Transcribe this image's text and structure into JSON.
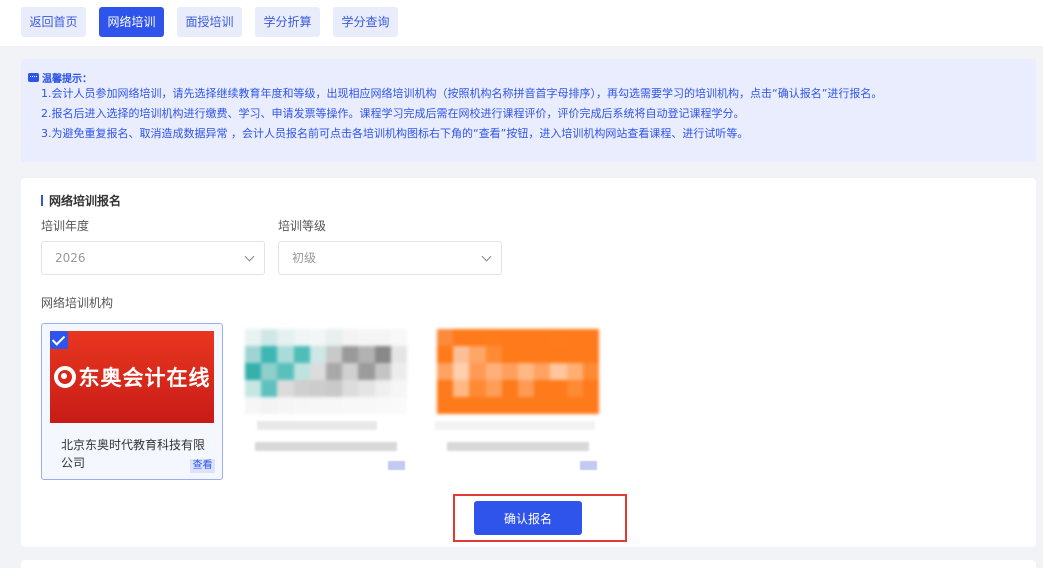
{
  "nav": {
    "tabs": [
      {
        "label": "返回首页"
      },
      {
        "label": "网络培训"
      },
      {
        "label": "面授培训"
      },
      {
        "label": "学分折算"
      },
      {
        "label": "学分查询"
      }
    ],
    "active": "网络培训"
  },
  "notice": {
    "title": "温馨提示：",
    "lines": [
      "1.会计人员参加网络培训，请先选择继续教育年度和等级，出现相应网络培训机构（按照机构名称拼音首字母排序），再勾选需要学习的培训机构，点击“确认报名”进行报名。",
      "2.报名后进入选择的培训机构进行缴费、学习、申请发票等操作。课程学习完成后需在网校进行课程评价，评价完成后系统将自动登记课程学分。",
      "3.为避免重复报名、取消造成数据异常 ，会计人员报名前可点击各培训机构图标右下角的“查看”按钮，进入培训机构网站查看课程、进行试听等。"
    ]
  },
  "form": {
    "section_title": "网络培训报名",
    "year_label": "培训年度",
    "year_value": "2026",
    "level_label": "培训等级",
    "level_value": "初级",
    "institutions_label": "网络培训机构"
  },
  "institutions": [
    {
      "logo_text": "东奥会计在线",
      "name": "北京东奥时代教育科技有限公司",
      "view_label": "查看",
      "selected": true
    }
  ],
  "confirm_label": "确认报名",
  "colors": {
    "accent": "#2f54eb",
    "highlight_border": "#e53935",
    "brand_red": "#d42a1c"
  }
}
